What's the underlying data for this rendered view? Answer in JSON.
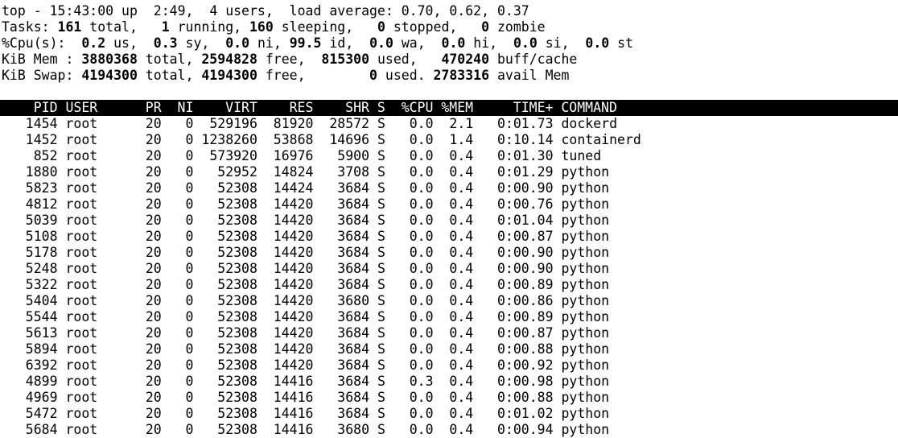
{
  "terminal": {
    "program": "top",
    "colors": {
      "background": "#ffffff",
      "foreground": "#000000",
      "header_background": "#000000",
      "header_foreground": "#ffffff"
    }
  },
  "summary": {
    "uptime_line": {
      "prefix": "top - ",
      "time": "15:43:00",
      "up_label": " up ",
      "uptime": " 2:49,",
      "users": "  4 users,",
      "load_label": "  load average: ",
      "load_1": "0.70",
      "load_5": "0.62",
      "load_15": "0.37"
    },
    "tasks_line": {
      "label": "Tasks: ",
      "total": "161",
      "total_label": " total,",
      "running": "1",
      "running_label": " running,",
      "sleeping": "160",
      "sleeping_label": " sleeping,",
      "stopped": "0",
      "stopped_label": " stopped,",
      "zombie": "0",
      "zombie_label": " zombie"
    },
    "cpu_line": {
      "label": "%Cpu(s): ",
      "us": "0.2",
      "us_label": " us,",
      "sy": "0.3",
      "sy_label": " sy,",
      "ni": "0.0",
      "ni_label": " ni,",
      "id": "99.5",
      "id_label": " id,",
      "wa": "0.0",
      "wa_label": " wa,",
      "hi": "0.0",
      "hi_label": " hi,",
      "si": "0.0",
      "si_label": " si,",
      "st": "0.0",
      "st_label": " st"
    },
    "mem_line": {
      "label": "KiB Mem : ",
      "total": "3880368",
      "total_label": " total,",
      "free": "2594828",
      "free_label": " free,",
      "used": "815300",
      "used_label": " used,",
      "buff_cache": "470240",
      "buff_cache_label": " buff/cache"
    },
    "swap_line": {
      "label": "KiB Swap: ",
      "total": "4194300",
      "total_label": " total,",
      "free": "4194300",
      "free_label": " free,",
      "used": "0",
      "used_label": " used.",
      "avail": "2783316",
      "avail_label": " avail Mem"
    }
  },
  "table": {
    "header_text": "    PID USER      PR  NI    VIRT    RES    SHR S  %CPU %MEM     TIME+ COMMAND",
    "columns": [
      "PID",
      "USER",
      "PR",
      "NI",
      "VIRT",
      "RES",
      "SHR",
      "S",
      "%CPU",
      "%MEM",
      "TIME+",
      "COMMAND"
    ],
    "rows": [
      {
        "pid": "1454",
        "user": "root",
        "pr": "20",
        "ni": "0",
        "virt": "529196",
        "res": "81920",
        "shr": "28572",
        "s": "S",
        "cpu": "0.0",
        "mem": "2.1",
        "time": "0:01.73",
        "command": "dockerd"
      },
      {
        "pid": "1452",
        "user": "root",
        "pr": "20",
        "ni": "0",
        "virt": "1238260",
        "res": "53868",
        "shr": "14696",
        "s": "S",
        "cpu": "0.0",
        "mem": "1.4",
        "time": "0:10.14",
        "command": "containerd"
      },
      {
        "pid": "852",
        "user": "root",
        "pr": "20",
        "ni": "0",
        "virt": "573920",
        "res": "16976",
        "shr": "5900",
        "s": "S",
        "cpu": "0.0",
        "mem": "0.4",
        "time": "0:01.30",
        "command": "tuned"
      },
      {
        "pid": "1880",
        "user": "root",
        "pr": "20",
        "ni": "0",
        "virt": "52952",
        "res": "14824",
        "shr": "3708",
        "s": "S",
        "cpu": "0.0",
        "mem": "0.4",
        "time": "0:01.29",
        "command": "python"
      },
      {
        "pid": "5823",
        "user": "root",
        "pr": "20",
        "ni": "0",
        "virt": "52308",
        "res": "14424",
        "shr": "3684",
        "s": "S",
        "cpu": "0.0",
        "mem": "0.4",
        "time": "0:00.90",
        "command": "python"
      },
      {
        "pid": "4812",
        "user": "root",
        "pr": "20",
        "ni": "0",
        "virt": "52308",
        "res": "14420",
        "shr": "3684",
        "s": "S",
        "cpu": "0.0",
        "mem": "0.4",
        "time": "0:00.76",
        "command": "python"
      },
      {
        "pid": "5039",
        "user": "root",
        "pr": "20",
        "ni": "0",
        "virt": "52308",
        "res": "14420",
        "shr": "3684",
        "s": "S",
        "cpu": "0.0",
        "mem": "0.4",
        "time": "0:01.04",
        "command": "python"
      },
      {
        "pid": "5108",
        "user": "root",
        "pr": "20",
        "ni": "0",
        "virt": "52308",
        "res": "14420",
        "shr": "3684",
        "s": "S",
        "cpu": "0.0",
        "mem": "0.4",
        "time": "0:00.87",
        "command": "python"
      },
      {
        "pid": "5178",
        "user": "root",
        "pr": "20",
        "ni": "0",
        "virt": "52308",
        "res": "14420",
        "shr": "3684",
        "s": "S",
        "cpu": "0.0",
        "mem": "0.4",
        "time": "0:00.90",
        "command": "python"
      },
      {
        "pid": "5248",
        "user": "root",
        "pr": "20",
        "ni": "0",
        "virt": "52308",
        "res": "14420",
        "shr": "3684",
        "s": "S",
        "cpu": "0.0",
        "mem": "0.4",
        "time": "0:00.90",
        "command": "python"
      },
      {
        "pid": "5322",
        "user": "root",
        "pr": "20",
        "ni": "0",
        "virt": "52308",
        "res": "14420",
        "shr": "3684",
        "s": "S",
        "cpu": "0.0",
        "mem": "0.4",
        "time": "0:00.89",
        "command": "python"
      },
      {
        "pid": "5404",
        "user": "root",
        "pr": "20",
        "ni": "0",
        "virt": "52308",
        "res": "14420",
        "shr": "3680",
        "s": "S",
        "cpu": "0.0",
        "mem": "0.4",
        "time": "0:00.86",
        "command": "python"
      },
      {
        "pid": "5544",
        "user": "root",
        "pr": "20",
        "ni": "0",
        "virt": "52308",
        "res": "14420",
        "shr": "3684",
        "s": "S",
        "cpu": "0.0",
        "mem": "0.4",
        "time": "0:00.89",
        "command": "python"
      },
      {
        "pid": "5613",
        "user": "root",
        "pr": "20",
        "ni": "0",
        "virt": "52308",
        "res": "14420",
        "shr": "3684",
        "s": "S",
        "cpu": "0.0",
        "mem": "0.4",
        "time": "0:00.87",
        "command": "python"
      },
      {
        "pid": "5894",
        "user": "root",
        "pr": "20",
        "ni": "0",
        "virt": "52308",
        "res": "14420",
        "shr": "3684",
        "s": "S",
        "cpu": "0.0",
        "mem": "0.4",
        "time": "0:00.88",
        "command": "python"
      },
      {
        "pid": "6392",
        "user": "root",
        "pr": "20",
        "ni": "0",
        "virt": "52308",
        "res": "14420",
        "shr": "3684",
        "s": "S",
        "cpu": "0.0",
        "mem": "0.4",
        "time": "0:00.92",
        "command": "python"
      },
      {
        "pid": "4899",
        "user": "root",
        "pr": "20",
        "ni": "0",
        "virt": "52308",
        "res": "14416",
        "shr": "3684",
        "s": "S",
        "cpu": "0.3",
        "mem": "0.4",
        "time": "0:00.98",
        "command": "python"
      },
      {
        "pid": "4969",
        "user": "root",
        "pr": "20",
        "ni": "0",
        "virt": "52308",
        "res": "14416",
        "shr": "3684",
        "s": "S",
        "cpu": "0.0",
        "mem": "0.4",
        "time": "0:00.88",
        "command": "python"
      },
      {
        "pid": "5472",
        "user": "root",
        "pr": "20",
        "ni": "0",
        "virt": "52308",
        "res": "14416",
        "shr": "3684",
        "s": "S",
        "cpu": "0.0",
        "mem": "0.4",
        "time": "0:01.02",
        "command": "python"
      },
      {
        "pid": "5684",
        "user": "root",
        "pr": "20",
        "ni": "0",
        "virt": "52308",
        "res": "14416",
        "shr": "3680",
        "s": "S",
        "cpu": "0.0",
        "mem": "0.4",
        "time": "0:00.94",
        "command": "python"
      }
    ]
  }
}
